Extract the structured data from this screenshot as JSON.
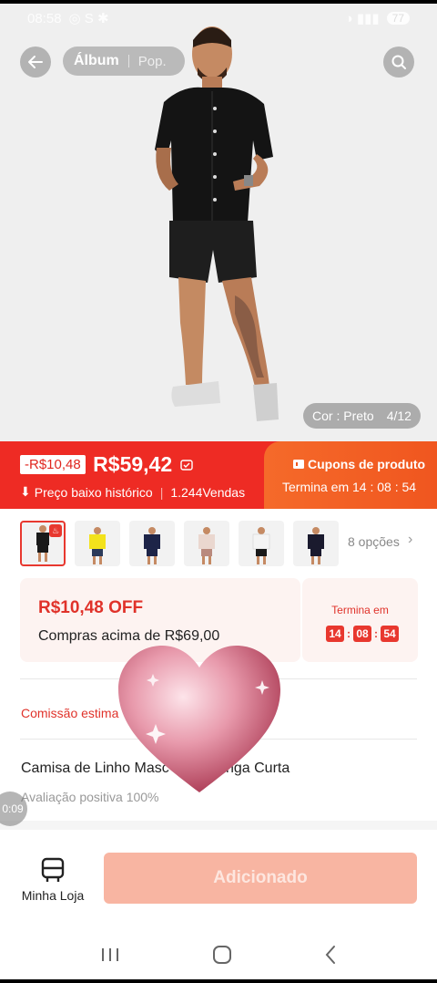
{
  "status_bar": {
    "time": "08:58",
    "battery": "77"
  },
  "gallery": {
    "tabs": [
      {
        "label": "Álbum",
        "active": true
      },
      {
        "label": "Pop.",
        "active": false
      }
    ],
    "color_label": "Cor : Preto",
    "image_counter": "4/12"
  },
  "price_bar": {
    "discount_tag": "-R$10,48",
    "price": "R$59,42",
    "history_label": "Preço baixo histórico",
    "sales": "1.244Vendas",
    "coupon_title": "Cupons de produto",
    "coupon_timer": "Termina em 14 : 08 : 54"
  },
  "variants": {
    "options_label": "8 opções",
    "thumbs": [
      {
        "shirt": "#1a1a1a",
        "shorts": "#1a1a1a",
        "selected": true
      },
      {
        "shirt": "#f3e21b",
        "shorts": "#2b3a5a",
        "selected": false
      },
      {
        "shirt": "#1d2448",
        "shorts": "#1d2448",
        "selected": false
      },
      {
        "shirt": "#ead7cf",
        "shorts": "#b98a7e",
        "selected": false
      },
      {
        "shirt": "#f4f4f4",
        "shorts": "#1a1a1a",
        "selected": false
      },
      {
        "shirt": "#1a1a2e",
        "shorts": "#1a1a2e",
        "selected": false
      }
    ]
  },
  "coupon": {
    "off_title": "R$10,48 OFF",
    "min_purchase": "Compras acima de R$69,00",
    "ends_label": "Termina em",
    "hours": "14",
    "minutes": "08",
    "seconds": "54"
  },
  "commission_label": "Comissão estima",
  "product": {
    "title": "Camisa de Linho Masc           n Fit Manga Curta",
    "rating": "Avaliação positiva 100%"
  },
  "video_time": "0:09",
  "bottom": {
    "store_label": "Minha Loja",
    "add_label": "Adicionado"
  },
  "colors": {
    "accent": "#ee2b24",
    "add_button": "#f8b5a2"
  }
}
